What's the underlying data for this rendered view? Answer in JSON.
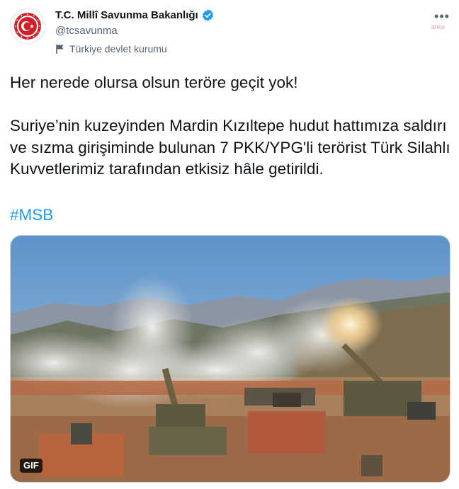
{
  "tweet": {
    "display_name": "T.C. Millî Savunma Bakanlığı",
    "handle": "@tcsavunma",
    "verified_icon": "verified-badge-icon",
    "account_label": "Türkiye devlet kurumu",
    "account_label_icon": "flag-icon",
    "more_icon": "more-options-icon",
    "watermark": "anka",
    "text": "Her nerede olursa olsun teröre geçit yok!\n\nSuriye’nin kuzeyinden Mardin Kızıltepe hudut hattımıza saldırı ve sızma girişiminde bulunan 7 PKK/YPG'li terörist Türk Silahlı Kuvvetlerimiz tarafından etkisiz hâle getirildi.",
    "hashtag": "#MSB",
    "media": {
      "type": "gif",
      "badge": "GIF"
    }
  },
  "colors": {
    "text": "#0f1419",
    "secondary": "#536471",
    "link": "#1d9bf0",
    "verified": "#1d9bf0",
    "emblem_red": "#d1202a"
  }
}
